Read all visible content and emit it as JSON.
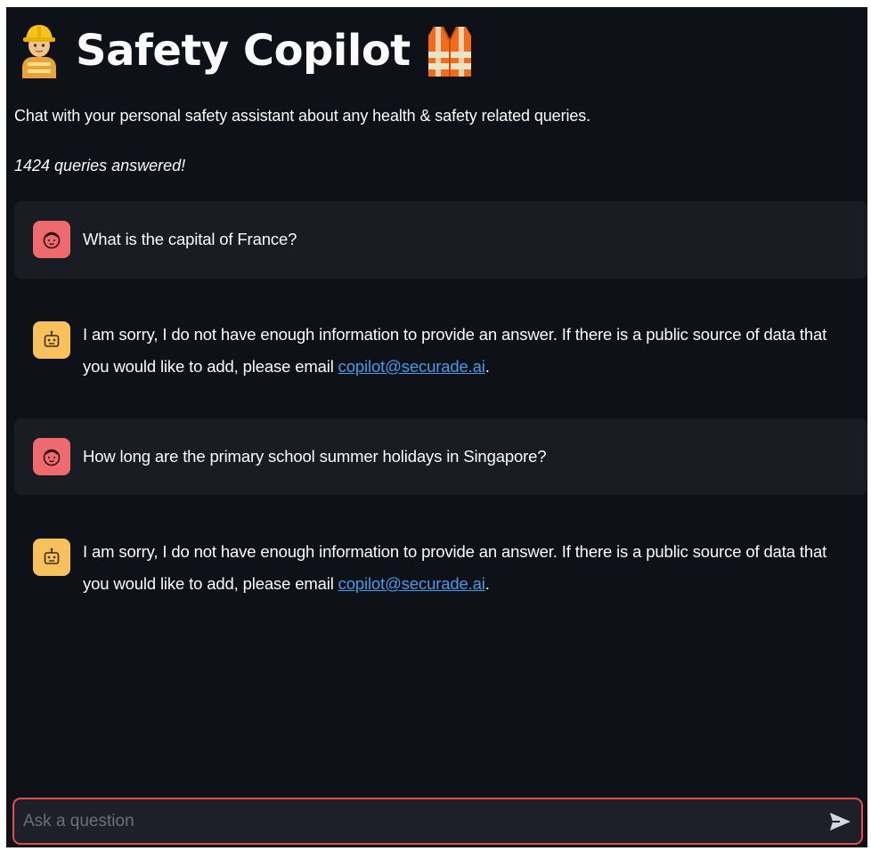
{
  "header": {
    "title": "Safety Copilot",
    "left_icon": "construction-worker-icon",
    "right_icon": "safety-vest-icon"
  },
  "subtitle": "Chat with your personal safety assistant about any health & safety related queries.",
  "queries_answered": "1424 queries answered!",
  "messages": [
    {
      "role": "user",
      "avatar_icon": "user-face-icon",
      "text": "What is the capital of France?"
    },
    {
      "role": "assistant",
      "avatar_icon": "robot-icon",
      "text_before_link": "I am sorry, I do not have enough information to provide an answer. If there is a public source of data that you would like to add, please email ",
      "link_text": "copilot@securade.ai",
      "text_after_link": "."
    },
    {
      "role": "user",
      "avatar_icon": "user-face-icon",
      "text": "How long are the primary school summer holidays in Singapore?"
    },
    {
      "role": "assistant",
      "avatar_icon": "robot-icon",
      "text_before_link": "I am sorry, I do not have enough information to provide an answer. If there is a public source of data that you would like to add, please email ",
      "link_text": "copilot@securade.ai",
      "text_after_link": "."
    }
  ],
  "chat_input": {
    "placeholder": "Ask a question",
    "value": "",
    "send_icon": "send-arrow-icon"
  },
  "colors": {
    "background": "#0e1117",
    "user_message_bg": "#1a1c24",
    "user_avatar": "#ef6a6e",
    "bot_avatar": "#f9c15d",
    "link": "#4a9ae8",
    "input_border": "#e0504c"
  }
}
